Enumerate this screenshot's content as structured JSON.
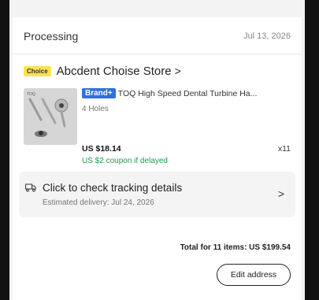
{
  "order": {
    "status": "Processing",
    "date": "Jul 13, 2026"
  },
  "store": {
    "badge": "Choice",
    "name": "Abcdent Choise Store",
    "chevron": ">"
  },
  "product": {
    "image_label": "TOQ",
    "brand_badge": "Brand+",
    "title": "TOQ High Speed Dental Turbine Ha...",
    "variant": "4 Holes",
    "price": "US $18.14",
    "quantity": "x11",
    "coupon": "US $2 coupon if delayed"
  },
  "tracking": {
    "title": "Click to check tracking details",
    "estimate": "Estimated delivery: Jul 24, 2026",
    "chevron": ">"
  },
  "summary": {
    "total": "Total for 11 items: US $199.54"
  },
  "actions": {
    "edit_address": "Edit address"
  },
  "colors": {
    "choice_badge": "#fce34d",
    "brand_badge": "#2f6fe0",
    "coupon_text": "#1e9a4e"
  }
}
